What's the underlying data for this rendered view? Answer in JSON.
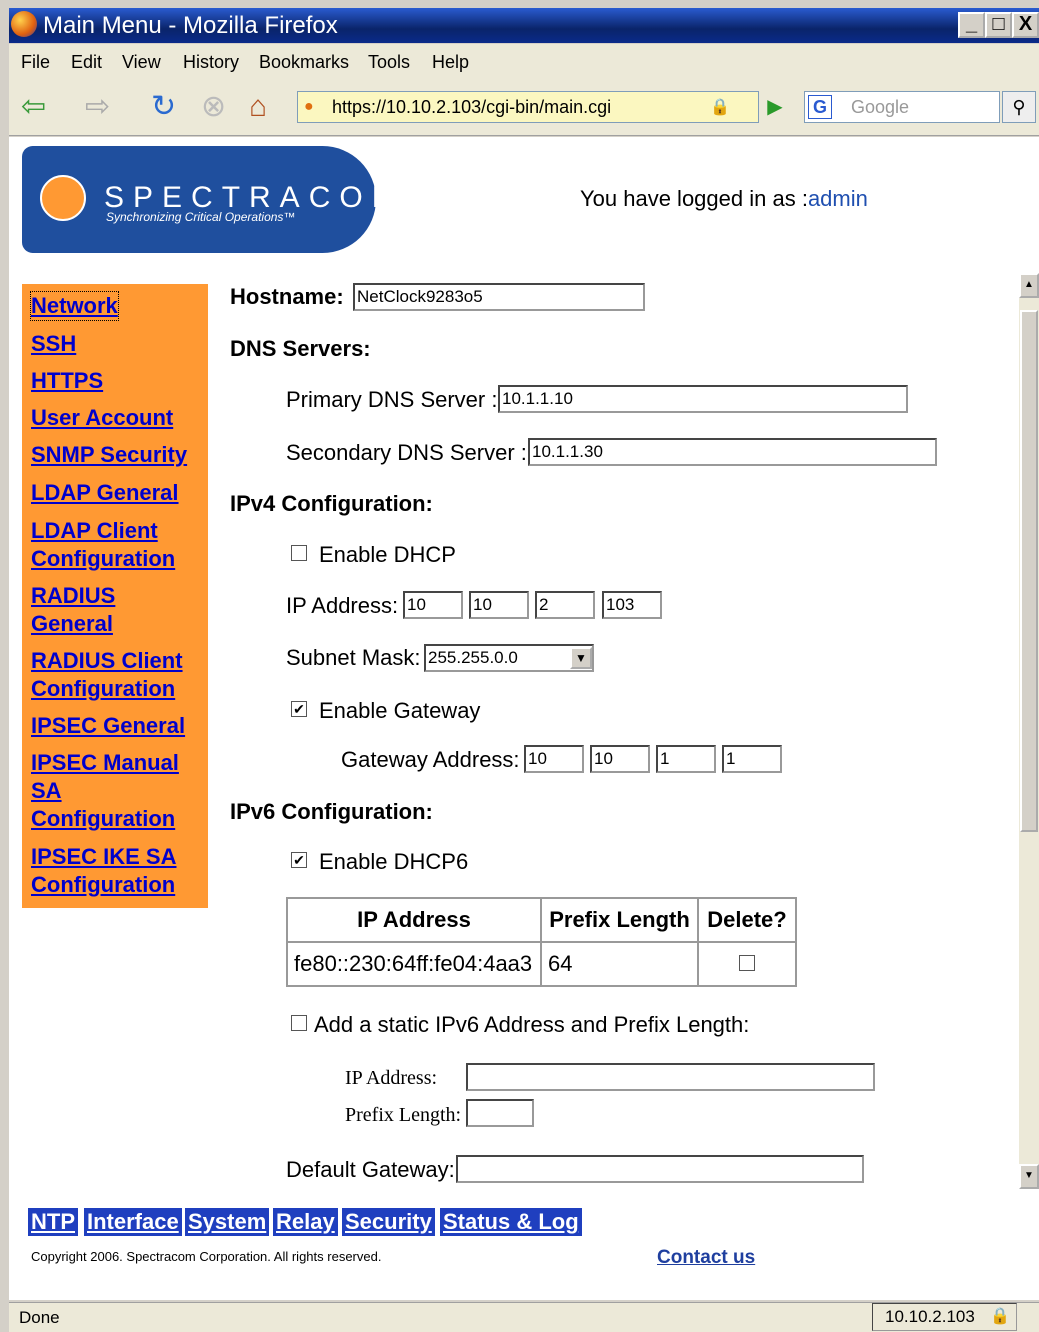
{
  "window": {
    "title": "Main Menu - Mozilla Firefox",
    "controls": [
      "_",
      "□",
      "X"
    ]
  },
  "menu": [
    "File",
    "Edit",
    "View",
    "History",
    "Bookmarks",
    "Tools",
    "Help"
  ],
  "nav": {
    "url": "https://10.10.2.103/cgi-bin/main.cgi",
    "search_placeholder": "Google"
  },
  "header": {
    "logo_text": "SPECTRACOM",
    "logo_tagline": "Synchronizing Critical Operations™",
    "login_prefix": "You have logged in as :",
    "login_user": "admin"
  },
  "sidebar": [
    {
      "label": "Network"
    },
    {
      "label": "SSH"
    },
    {
      "label": "HTTPS"
    },
    {
      "label": "User Account"
    },
    {
      "label": "SNMP Security"
    },
    {
      "label": "LDAP General"
    },
    {
      "label": "LDAP Client Configuration"
    },
    {
      "label": "RADIUS General"
    },
    {
      "label": "RADIUS Client Configuration"
    },
    {
      "label": "IPSEC General"
    },
    {
      "label": "IPSEC Manual SA Configuration"
    },
    {
      "label": "IPSEC IKE SA Configuration"
    }
  ],
  "form": {
    "hostname_label": "Hostname:",
    "hostname": "NetClock9283o5",
    "dns_header": "DNS Servers:",
    "primary_dns_label": "Primary DNS Server :",
    "primary_dns": "10.1.1.10",
    "secondary_dns_label": "Secondary DNS Server :",
    "secondary_dns": "10.1.1.30",
    "ipv4_header": "IPv4 Configuration:",
    "enable_dhcp_label": "Enable DHCP",
    "enable_dhcp": false,
    "ip_label": "IP Address:",
    "ip": [
      "10",
      "10",
      "2",
      "103"
    ],
    "subnet_label": "Subnet Mask:",
    "subnet": "255.255.0.0",
    "enable_gateway_label": "Enable Gateway",
    "enable_gateway": true,
    "gateway_label": "Gateway Address:",
    "gateway": [
      "10",
      "10",
      "1",
      "1"
    ],
    "ipv6_header": "IPv6 Configuration:",
    "enable_dhcp6_label": "Enable DHCP6",
    "enable_dhcp6": true,
    "ipv6_table": {
      "headers": [
        "IP Address",
        "Prefix Length",
        "Delete?"
      ],
      "rows": [
        {
          "ip": "fe80::230:64ff:fe04:4aa3",
          "prefix": "64",
          "delete": false
        }
      ]
    },
    "add_static_label": "Add a static IPv6 Address and Prefix Length:",
    "static_ip_label": "IP Address:",
    "static_ip": "",
    "prefix_label": "Prefix Length:",
    "prefix": "",
    "default_gw_label": "Default Gateway:",
    "default_gw": ""
  },
  "tabs": [
    "NTP",
    "Interface",
    "System",
    "Relay",
    "Security",
    "Status & Log"
  ],
  "footer": {
    "copyright": "Copyright 2006. Spectracom Corporation. All rights reserved.",
    "contact": "Contact us"
  },
  "status": {
    "text": "Done",
    "host": "10.10.2.103"
  }
}
